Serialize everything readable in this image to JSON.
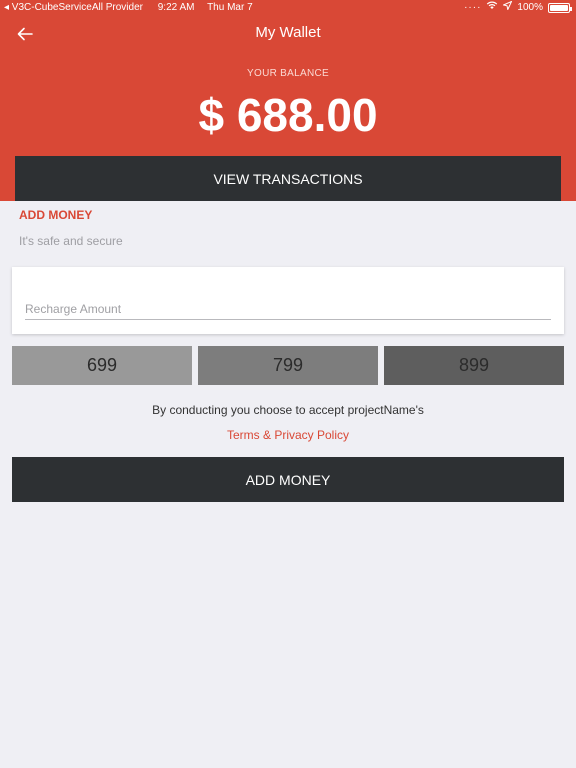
{
  "status_bar": {
    "carrier": "◂ V3C-CubeServiceAll Provider",
    "time": "9:22 AM",
    "date": "Thu Mar 7",
    "battery": "100%"
  },
  "header": {
    "title": "My Wallet",
    "balance_label": "YOUR BALANCE",
    "balance_amount": "$ 688.00",
    "view_transactions_label": "VIEW TRANSACTIONS"
  },
  "add_money": {
    "heading": "ADD MONEY",
    "subtitle": "It's safe and secure",
    "recharge_placeholder": "Recharge Amount",
    "recharge_value": "",
    "amount_options": [
      "699",
      "799",
      "899"
    ],
    "terms_text": "By conducting you choose to accept projectName's",
    "terms_link": "Terms & Privacy Policy",
    "button_label": "ADD MONEY"
  },
  "colors": {
    "brand": "#d94836",
    "dark_button": "#2d3033",
    "background": "#efeff4"
  },
  "icons": {
    "back": "arrow-left-icon",
    "wifi": "wifi-icon",
    "location": "location-arrow-icon",
    "battery": "battery-icon"
  }
}
